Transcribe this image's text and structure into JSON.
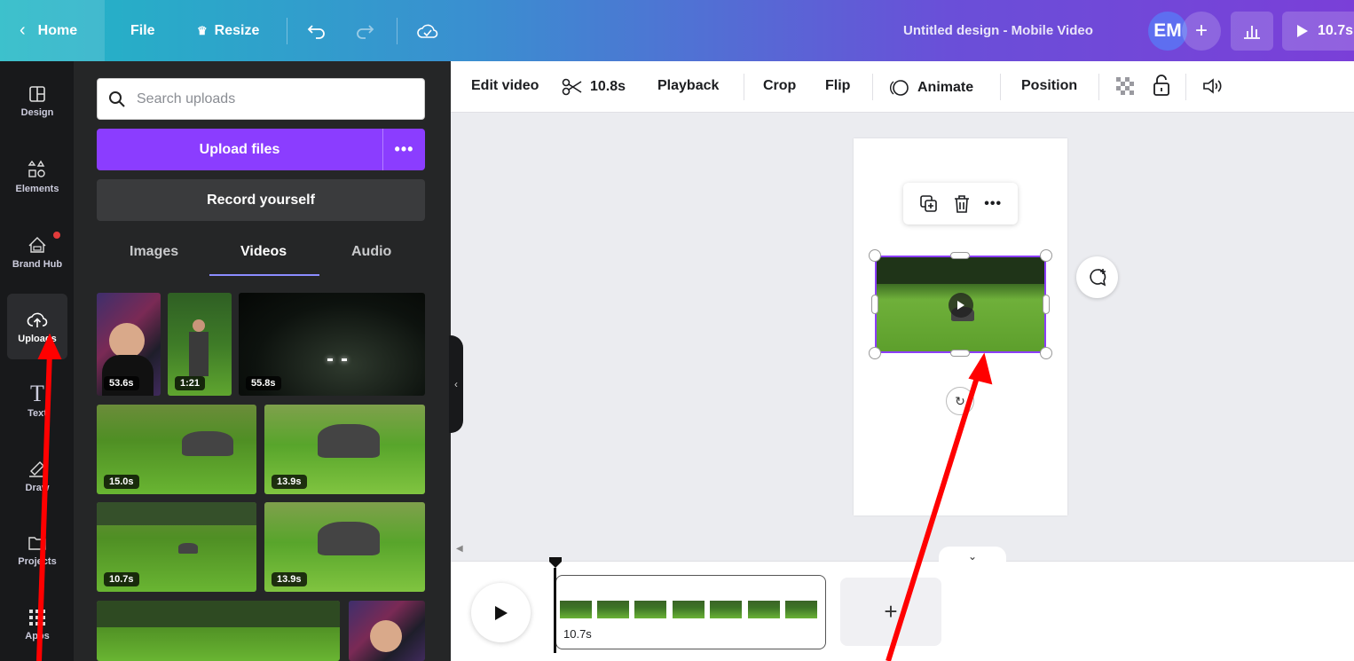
{
  "topbar": {
    "home_label": "Home",
    "file_label": "File",
    "resize_label": "Resize",
    "design_title": "Untitled design - Mobile Video",
    "avatar_initials": "EM",
    "play_duration": "10.7s"
  },
  "rail": {
    "items": [
      {
        "label": "Design",
        "icon": "layout-icon"
      },
      {
        "label": "Elements",
        "icon": "shapes-icon"
      },
      {
        "label": "Brand Hub",
        "icon": "brand-hub-icon"
      },
      {
        "label": "Uploads",
        "icon": "cloud-upload-icon"
      },
      {
        "label": "Text",
        "icon": "text-icon"
      },
      {
        "label": "Draw",
        "icon": "draw-icon"
      },
      {
        "label": "Projects",
        "icon": "folder-icon"
      },
      {
        "label": "Apps",
        "icon": "apps-grid-icon"
      }
    ]
  },
  "panel": {
    "search_placeholder": "Search uploads",
    "upload_label": "Upload files",
    "record_label": "Record yourself",
    "tabs": [
      "Images",
      "Videos",
      "Audio"
    ],
    "active_tab": "Videos",
    "videos": [
      {
        "duration": "53.6s"
      },
      {
        "duration": "1:21"
      },
      {
        "duration": "55.8s"
      },
      {
        "duration": "15.0s"
      },
      {
        "duration": "13.9s"
      },
      {
        "duration": "10.7s"
      },
      {
        "duration": "13.9s"
      }
    ]
  },
  "toolbar": {
    "edit_video": "Edit video",
    "trim_duration": "10.8s",
    "playback": "Playback",
    "crop": "Crop",
    "flip": "Flip",
    "animate": "Animate",
    "position": "Position"
  },
  "timeline": {
    "clip_duration": "10.7s"
  },
  "colors": {
    "accent": "#8b3dff",
    "annotation_arrow": "#ff0000"
  }
}
